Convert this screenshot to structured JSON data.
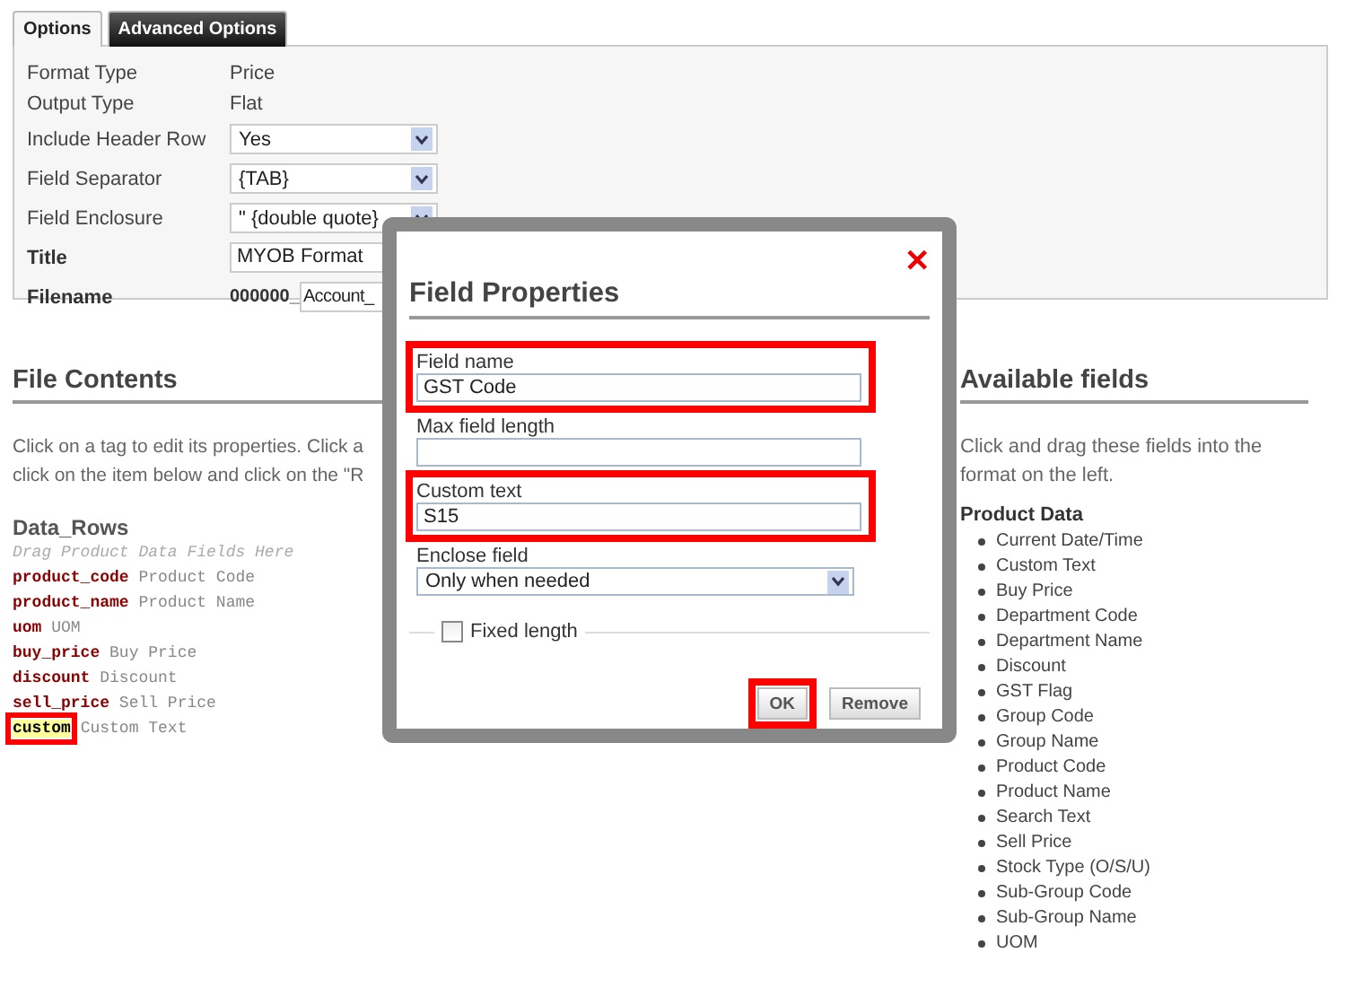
{
  "tabs": [
    {
      "label": "Options",
      "selected": true
    },
    {
      "label": "Advanced Options",
      "selected": false
    }
  ],
  "options": [
    {
      "kind": "text",
      "label": "Format Type",
      "bold": false,
      "value": "Price"
    },
    {
      "kind": "text",
      "label": "Output Type",
      "bold": false,
      "value": "Flat"
    },
    {
      "kind": "select",
      "label": "Include Header Row",
      "bold": false,
      "value": "Yes"
    },
    {
      "kind": "select",
      "label": "Field Separator",
      "bold": false,
      "value": "{TAB}"
    },
    {
      "kind": "select",
      "label": "Field Enclosure",
      "bold": false,
      "value": "\" {double quote}"
    },
    {
      "kind": "input",
      "label": "Title",
      "bold": true,
      "value": "MYOB Format"
    },
    {
      "kind": "filename",
      "label": "Filename",
      "bold": true,
      "prefix": "000000_",
      "value": "Account_"
    }
  ],
  "file_contents": {
    "heading": "File Contents",
    "lines": [
      "Click on a tag to edit its properties. Click a",
      "click on the item below and click on the \"R"
    ],
    "section": "Data_Rows",
    "hint": "Drag Product Data Fields Here",
    "tags": [
      {
        "tag": "product_code",
        "label": "Product Code",
        "selected": false
      },
      {
        "tag": "product_name",
        "label": "Product Name",
        "selected": false
      },
      {
        "tag": "uom",
        "label": "UOM",
        "selected": false
      },
      {
        "tag": "buy_price",
        "label": "Buy Price",
        "selected": false
      },
      {
        "tag": "discount",
        "label": "Discount",
        "selected": false
      },
      {
        "tag": "sell_price",
        "label": "Sell Price",
        "selected": false
      },
      {
        "tag": "custom",
        "label": "Custom Text",
        "selected": true
      }
    ]
  },
  "available": {
    "heading": "Available fields",
    "text": "Click and drag these fields into the format on the left.",
    "group": "Product Data",
    "fields": [
      "Current Date/Time",
      "Custom Text",
      "Buy Price",
      "Department Code",
      "Department Name",
      "Discount",
      "GST Flag",
      "Group Code",
      "Group Name",
      "Product Code",
      "Product Name",
      "Search Text",
      "Sell Price",
      "Stock Type (O/S/U)",
      "Sub-Group Code",
      "Sub-Group Name",
      "UOM"
    ]
  },
  "dialog": {
    "title": "Field Properties",
    "close": "✕",
    "fields": [
      {
        "kind": "input",
        "label": "Field name",
        "value": "GST Code",
        "highlighted": true
      },
      {
        "kind": "input",
        "label": "Max field length",
        "highlighted": false
      },
      {
        "kind": "input",
        "label": "Custom text",
        "value": "S15",
        "highlighted": true
      },
      {
        "kind": "select",
        "label": "Enclose field",
        "value": "Only when needed",
        "highlighted": false
      }
    ],
    "fixed_length": {
      "label": "Fixed length",
      "checked": false
    },
    "buttons": [
      {
        "label": "OK",
        "highlighted": true
      },
      {
        "label": "Remove",
        "highlighted": false
      }
    ]
  }
}
